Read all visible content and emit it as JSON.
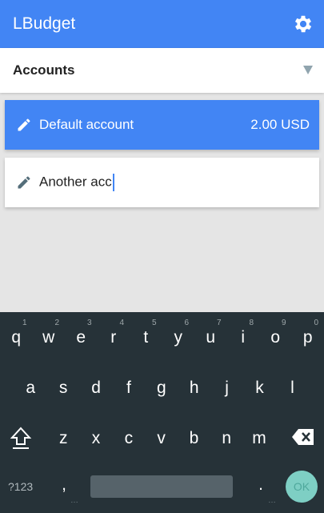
{
  "app_bar": {
    "title": "LBudget",
    "color": "#4285f4",
    "settings_icon": "gear-icon"
  },
  "account_selector": {
    "label": "Accounts",
    "icon": "dropdown-triangle-icon"
  },
  "accounts": [
    {
      "name": "Default account",
      "balance": "2.00 USD",
      "selected": true,
      "icon": "pencil-icon"
    },
    {
      "name_value": "Another acc",
      "editing": true,
      "icon": "pencil-icon"
    }
  ],
  "keyboard": {
    "row1": [
      "q",
      "w",
      "e",
      "r",
      "t",
      "y",
      "u",
      "i",
      "o",
      "p"
    ],
    "row1_hints": [
      "1",
      "2",
      "3",
      "4",
      "5",
      "6",
      "7",
      "8",
      "9",
      "0"
    ],
    "row2": [
      "a",
      "s",
      "d",
      "f",
      "g",
      "h",
      "j",
      "k",
      "l"
    ],
    "row3": [
      "z",
      "x",
      "c",
      "v",
      "b",
      "n",
      "m"
    ],
    "symbols_label": "?123",
    "comma": ",",
    "period": ".",
    "ok_label": "OK",
    "shift_icon": "shift-icon",
    "backspace_icon": "backspace-icon"
  }
}
